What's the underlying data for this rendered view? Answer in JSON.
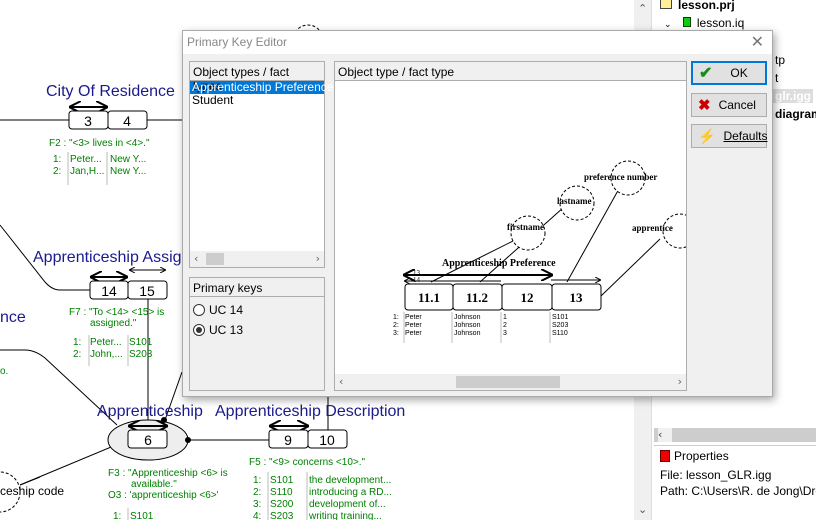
{
  "diagram": {
    "city_of_residence": {
      "title": "City Of Residence",
      "roles": [
        "3",
        "4"
      ],
      "fact": "F2 : \"<3> lives in <4>.\"",
      "rows": [
        [
          "1:",
          "Peter...",
          "New Y..."
        ],
        [
          "2:",
          "Jan,H...",
          "New Y..."
        ]
      ]
    },
    "apprenticeship_assignment": {
      "title": "Apprenticeship Assign",
      "roles": [
        "14",
        "15"
      ],
      "fact_line1": "F7 : \"To <14> <15> is",
      "fact_line2": "assigned.\"",
      "rows": [
        [
          "1:",
          "Peter...",
          "S101"
        ],
        [
          "2:",
          "John,...",
          "S203"
        ]
      ]
    },
    "left_fragment_title": "nce",
    "left_fragment_green": "o.",
    "apprenticeship": {
      "title": "Apprenticeship",
      "role": "6",
      "fact_line1": "F3  : \"Apprenticeship <6> is",
      "fact_line2": "available.\"",
      "object_line": "O3 : 'apprenticeship <6>'",
      "rows": [
        [
          "1:",
          "S101"
        ]
      ]
    },
    "apprenticeship_description": {
      "title": "Apprenticeship Description",
      "roles": [
        "9",
        "10"
      ],
      "fact": "F5 : \"<9> concerns <10>.\"",
      "rows": [
        [
          "1:",
          "S101",
          "the development..."
        ],
        [
          "2:",
          "S110",
          "introducing a RD..."
        ],
        [
          "3:",
          "S200",
          "development of..."
        ],
        [
          "4:",
          "S203",
          "writing training..."
        ]
      ]
    },
    "apprenticeship_code_label": "ceship code"
  },
  "right_pane": {
    "tree": [
      {
        "label": "lesson.prj",
        "icon": "folder-icon"
      },
      {
        "label": "lesson.iq",
        "icon": "database-icon"
      },
      {
        "label": "tp"
      },
      {
        "label": "t"
      },
      {
        "label": "glr.igg",
        "selected": true
      },
      {
        "label": "diagram"
      }
    ],
    "properties": {
      "title": "Properties",
      "file": "File: lesson_GLR.igg",
      "path": "Path: C:\\Users\\R. de Jong\\Dro"
    }
  },
  "dialog": {
    "title": "Primary Key Editor",
    "list_header": "Object types / fact types",
    "list_items": [
      {
        "label": "Apprenticeship Preference",
        "selected": true
      },
      {
        "label": "Student",
        "selected": false
      }
    ],
    "primary_keys_header": "Primary keys",
    "primary_keys": [
      {
        "label": "UC 14",
        "checked": false
      },
      {
        "label": "UC 13",
        "checked": true
      }
    ],
    "view_header": "Object type / fact type",
    "buttons": {
      "ok": "OK",
      "cancel": "Cancel",
      "defaults": "Defaults"
    },
    "preview": {
      "title": "Apprenticeship Preference",
      "roles": [
        "11.1",
        "11.2",
        "12",
        "13"
      ],
      "objects": [
        "firstname",
        "lastname",
        "preference number",
        "apprentice"
      ],
      "uc_labels": [
        "13",
        "14"
      ],
      "rows": [
        [
          "1:",
          "Peter",
          "Johnson",
          "1",
          "S101"
        ],
        [
          "2:",
          "Peter",
          "Johnson",
          "2",
          "S203"
        ],
        [
          "3:",
          "Peter",
          "Johnson",
          "3",
          "S110"
        ]
      ]
    }
  },
  "colors": {
    "title_blue": "#1a1a8c",
    "fact_green": "#008000",
    "selection": "#0078d7"
  }
}
